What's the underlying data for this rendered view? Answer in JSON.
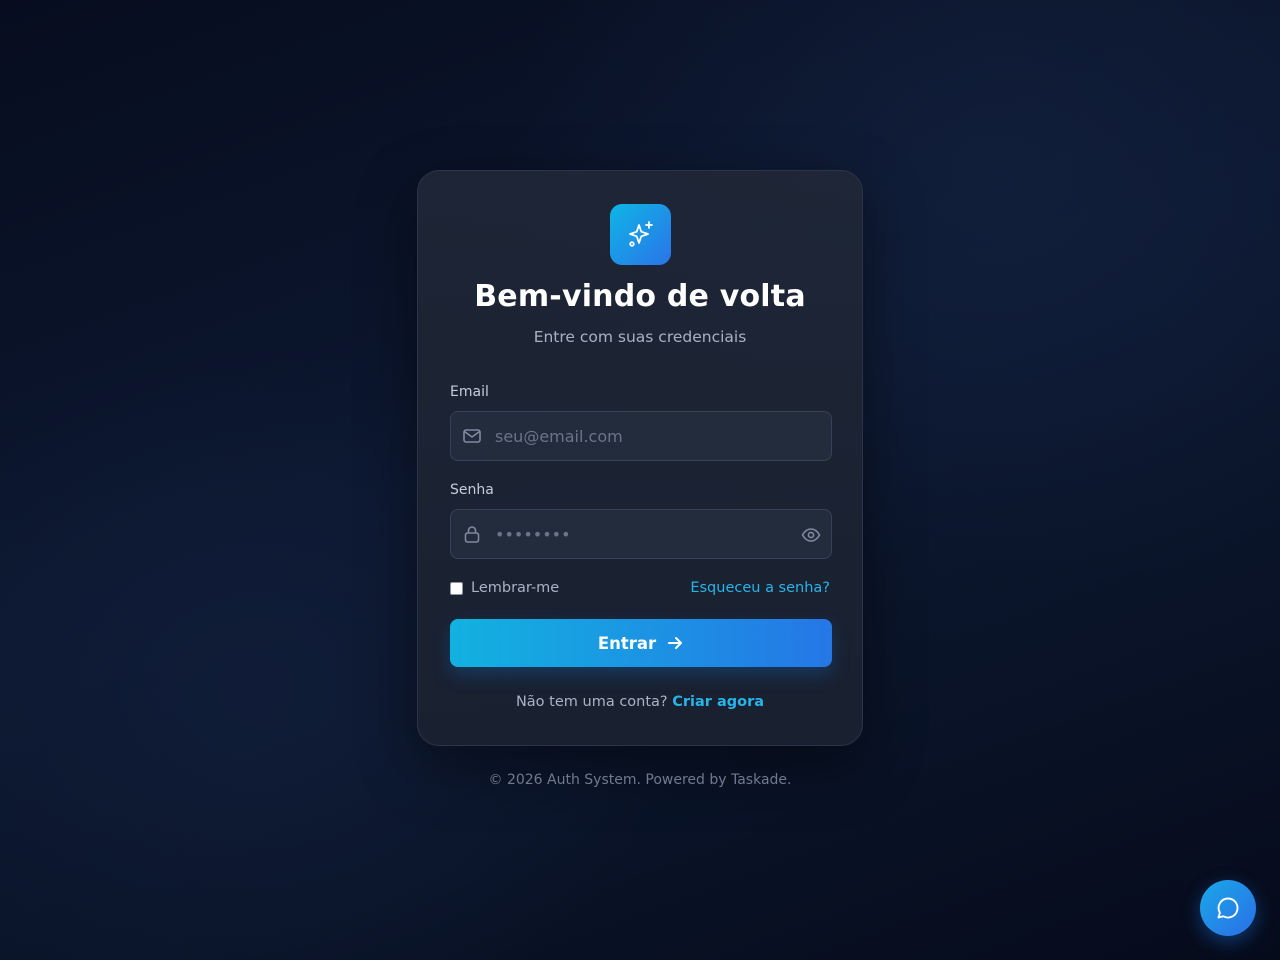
{
  "login": {
    "title": "Bem-vindo de volta",
    "subtitle": "Entre com suas credenciais",
    "email": {
      "label": "Email",
      "placeholder": "seu@email.com",
      "value": "",
      "icon": "mail-icon"
    },
    "password": {
      "label": "Senha",
      "placeholder": "••••••••",
      "value": "",
      "icon": "lock-icon",
      "toggle_icon": "eye-icon"
    },
    "remember_label": "Lembrar-me",
    "remember_checked": false,
    "forgot_label": "Esqueceu a senha?",
    "submit_label": "Entrar",
    "signup_prompt": "Não tem uma conta?",
    "signup_link": "Criar agora"
  },
  "logo_icon": "sparkles-icon",
  "footer": "© 2026 Auth System. Powered by Taskade.",
  "chat_icon": "chat-bubble-icon",
  "colors": {
    "accent": "#27b4e8",
    "button_start": "#12b2e0",
    "button_end": "#2577e6",
    "card_bg": "#1f2737",
    "page_bg": "#0a1429"
  }
}
